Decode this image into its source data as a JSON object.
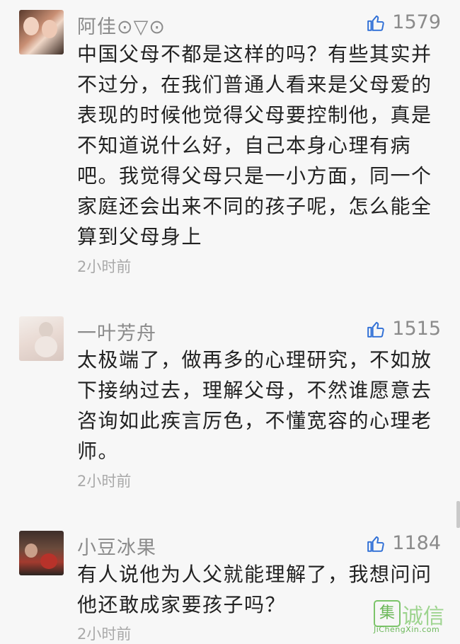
{
  "comments": [
    {
      "author": "阿佳⊙▽⊙",
      "likes": "1579",
      "lines": [
        "中国父母不都是这样的吗？有些其实并",
        "不过分，在我们普通人看来是父母爱的",
        "表现的时候他觉得父母要控制他，真是",
        "不知道说什么好，自己本身心理有病",
        "吧。我觉得父母只是一小方面，同一个",
        "家庭还会出来不同的孩子呢，怎么能全",
        "算到父母身上"
      ],
      "time": "2小时前"
    },
    {
      "author": "一叶芳舟",
      "likes": "1515",
      "lines": [
        "太极端了，做再多的心理研究，不如放",
        "下接纳过去，理解父母，不然谁愿意去",
        "咨询如此疾言厉色，不懂宽容的心理老",
        "师。"
      ],
      "time": "2小时前"
    },
    {
      "author": "小豆冰果",
      "likes": "1184",
      "lines": [
        "有人说他为人父就能理解了，我想问问",
        "他还敢成家要孩子吗？"
      ],
      "time": "2小时前"
    }
  ],
  "icons": {
    "like": "thumbs-up-icon"
  },
  "watermark": {
    "box_char": "集",
    "text": "诚信",
    "url": "JiChengXin.com"
  },
  "colors": {
    "background": "#f7f7f7",
    "meta": "#8b8b8b",
    "body": "#222222",
    "like_icon": "#2f6fd6"
  }
}
